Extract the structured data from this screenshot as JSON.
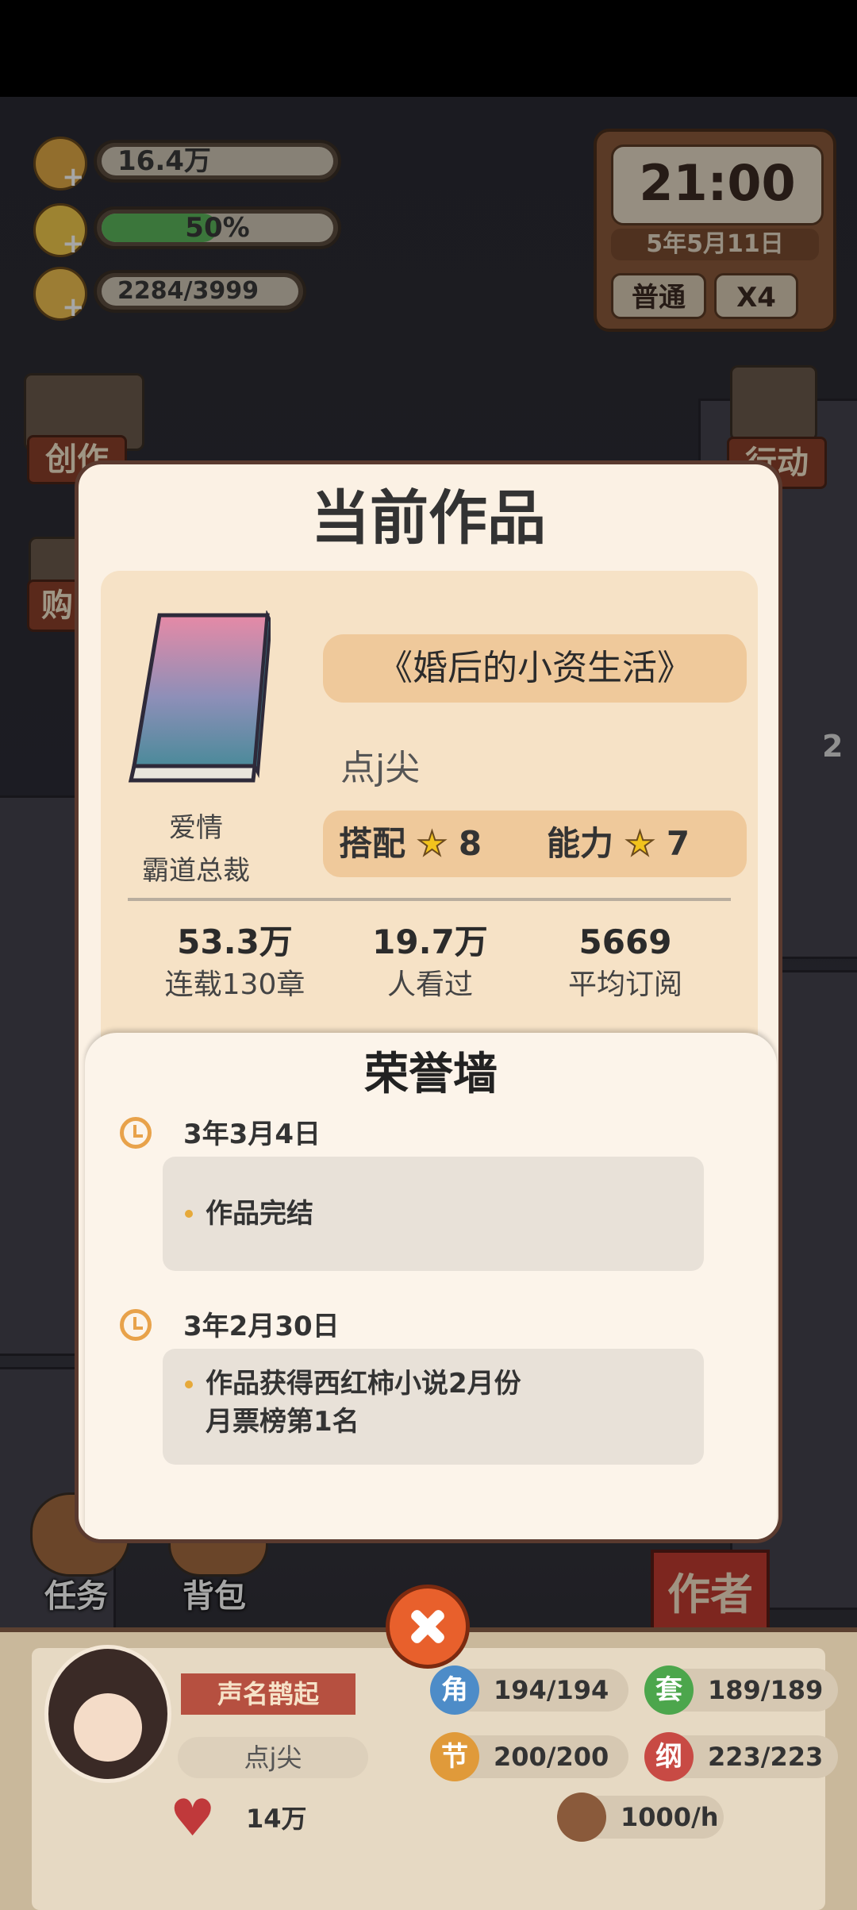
{
  "resources": {
    "coins": "16.4万",
    "energy": "50%",
    "energy_fraction": 0.5,
    "ideas": "2284/3999"
  },
  "clock": {
    "time": "21:00",
    "date": "5年5月11日",
    "mode_button": "普通",
    "speed_button": "X4"
  },
  "background": {
    "left_buttons": [
      "创作",
      "购"
    ],
    "right_buttons": [
      "行动"
    ],
    "right_badge": "2"
  },
  "modal": {
    "title": "当前作品",
    "book": {
      "genre_1": "爱情",
      "genre_2": "霸道总裁",
      "name": "《婚后的小资生活》",
      "author": "点j尖",
      "match_label": "搭配",
      "match_stars": "8",
      "ability_label": "能力",
      "ability_stars": "7"
    },
    "stats": [
      {
        "value": "53.3万",
        "label": "连载130章"
      },
      {
        "value": "19.7万",
        "label": "人看过"
      },
      {
        "value": "5669",
        "label": "平均订阅"
      }
    ],
    "honor": {
      "title": "荣誉墙",
      "entries": [
        {
          "date": "3年3月4日",
          "text": "作品完结"
        },
        {
          "date": "3年2月30日",
          "text": "作品获得西红柿小说2月份\n月票榜第1名"
        }
      ]
    }
  },
  "bottom": {
    "tasks_label": "任务",
    "bag_label": "背包",
    "author_tab": "作者",
    "title_banner": "声名鹊起",
    "player_name": "点j尖",
    "likes": "14万",
    "stats": {
      "jiao_icon": "角",
      "jiao": "194/194",
      "tao_icon": "套",
      "tao": "189/189",
      "jie_icon": "节",
      "jie": "200/200",
      "gang_icon": "纲",
      "gang": "223/223",
      "rate": "1000/h"
    },
    "colors": {
      "jiao": "#4d8cc8",
      "tao": "#4ca64c",
      "jie": "#e09a3a",
      "gang": "#c84a44"
    }
  }
}
